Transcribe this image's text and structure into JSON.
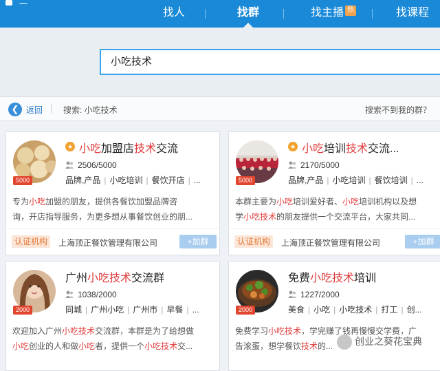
{
  "header": {
    "logo": "一",
    "nav": [
      {
        "label": "找人"
      },
      {
        "label": "找群"
      },
      {
        "label": "找主播",
        "badge": "热"
      },
      {
        "label": "找课程"
      }
    ]
  },
  "search": {
    "value": "小吃技术"
  },
  "breadcrumb": {
    "back": "返回",
    "query": "搜索: 小吃技术",
    "help": "搜索不到我的群？"
  },
  "cards": [
    {
      "title_parts": [
        "小吃",
        "加盟店",
        "技术",
        "交流"
      ],
      "members": "2506/5000",
      "capacity_badge": "5000",
      "tags": [
        "品牌,产品",
        "小吃培训",
        "餐饮开店",
        "..."
      ],
      "desc": [
        [
          "专为",
          "小吃",
          "加盟的朋友，提供各餐饮加盟品牌咨"
        ],
        [
          "询，开店指导服务，为更多想从事餐饮创业的朋..."
        ]
      ],
      "cert": "认证机构",
      "company": "上海顶正餐饮管理有限公司",
      "join": "+加群"
    },
    {
      "title_parts": [
        "小吃",
        "培训",
        "技术",
        "交流..."
      ],
      "members": "2170/5000",
      "capacity_badge": "5000",
      "tags": [
        "品牌,产品",
        "小吃培训",
        "餐饮培训",
        "..."
      ],
      "desc": [
        [
          "本群主要为",
          "小吃",
          "培训爱好者、",
          "小吃",
          "培训机构以及想"
        ],
        [
          "学",
          "小吃技术",
          "的朋友提供一个交流平台，大家共同..."
        ]
      ],
      "cert": "认证机构",
      "company": "上海顶正餐饮管理有限公司",
      "join": "+加群"
    },
    {
      "title_parts": [
        "广州",
        "小吃技术",
        "交流群"
      ],
      "members": "1038/2000",
      "capacity_badge": "2000",
      "tags": [
        "同城",
        "广州小吃",
        "广州市",
        "早餐",
        "..."
      ],
      "desc": [
        [
          "欢迎加入广州",
          "小吃技术",
          "交流群，本群是为了给想做"
        ],
        [
          "小吃",
          "创业的人和做",
          "小吃",
          "者，提供一个",
          "小吃技术",
          "交..."
        ]
      ]
    },
    {
      "title_parts": [
        "免费",
        "小吃技术",
        "培训"
      ],
      "members": "1227/2000",
      "capacity_badge": "2000",
      "tags": [
        "美食",
        "小吃",
        "小吃技术",
        "打工",
        "创..."
      ],
      "desc": [
        [
          "免费学习",
          "小吃技术",
          "，学完赚了钱再慢慢交学费，广"
        ],
        [
          "告滚蛋，想学餐饮",
          "技术",
          "的..."
        ]
      ]
    }
  ],
  "watermark": "创业之葵花宝典",
  "colors": {
    "brand": "#1a8ad8",
    "highlight": "#e23b3b",
    "badge": "#e2452e",
    "cert": "#e27a3b"
  }
}
